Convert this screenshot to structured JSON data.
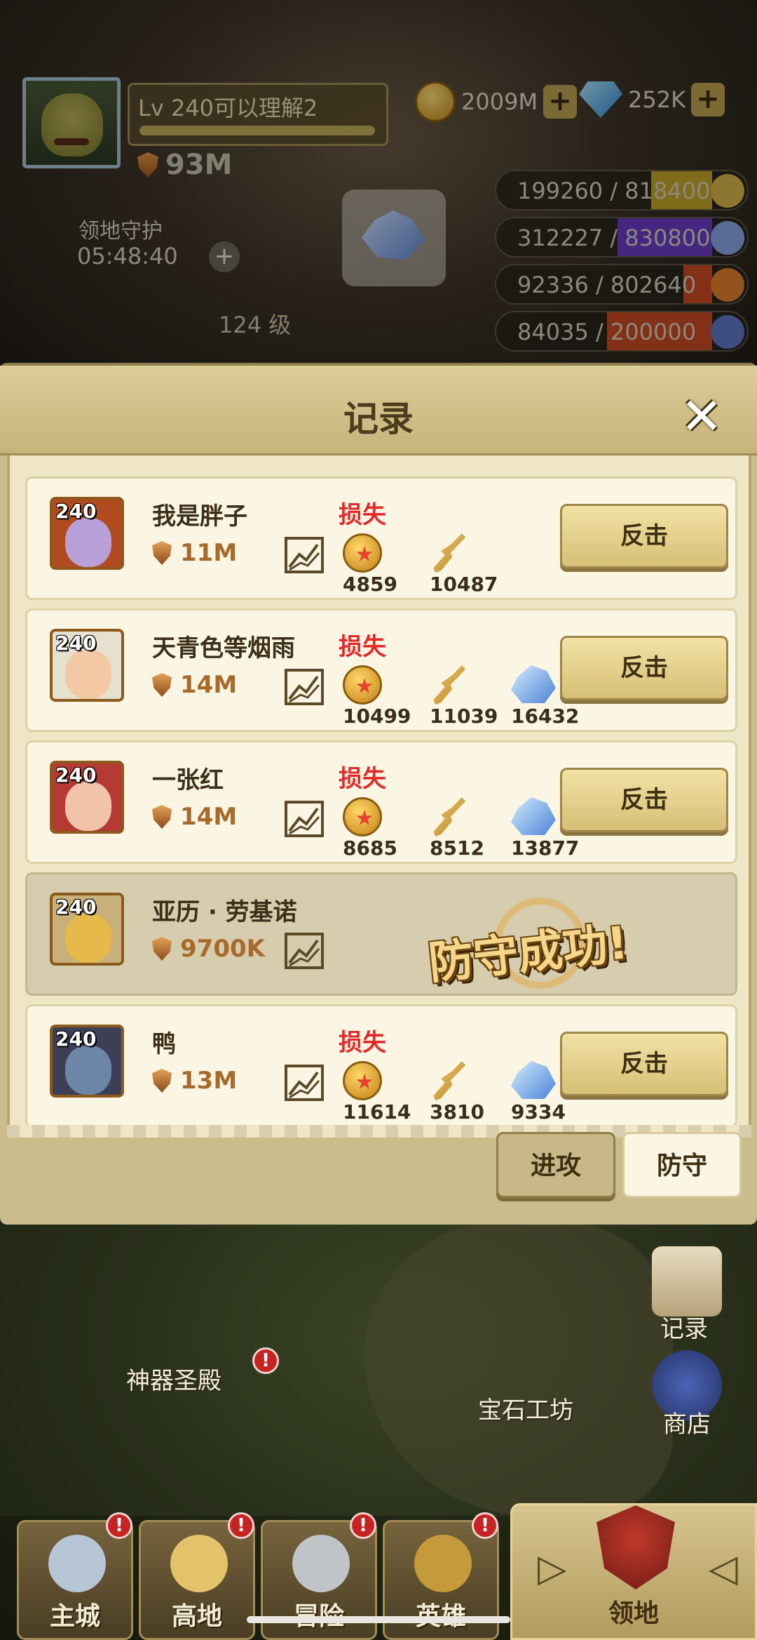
{
  "hud": {
    "player_level": "Lv 240可以理解2",
    "power": "93M",
    "territory_guard_label": "领地守护",
    "territory_guard_time": "05:48:40",
    "gold": "2009M",
    "gems": "252K",
    "building_level": "124 级"
  },
  "resources": [
    {
      "text": "199260 / 818400",
      "fill": 0.243,
      "color": "#c5a52a"
    },
    {
      "text": "312227 / 830800",
      "fill": 0.376,
      "color": "#6b3cc7"
    },
    {
      "text": "92336 / 802640",
      "fill": 0.115,
      "color": "#c94a23"
    },
    {
      "text": "84035 / 200000",
      "fill": 0.42,
      "color": "#c94a23"
    }
  ],
  "modal": {
    "title": "记录",
    "close_icon": "close-icon",
    "loss_label": "损失",
    "counter_label": "反击",
    "win_stamp": "防守成功!",
    "tabs": {
      "attack": "进攻",
      "defend": "防守"
    }
  },
  "records": [
    {
      "level": "240",
      "name": "我是胖子",
      "power": "11M",
      "result": "loss",
      "loot": {
        "gold": "4859",
        "food": "10487",
        "crystal": ""
      }
    },
    {
      "level": "240",
      "name": "天青色等烟雨",
      "power": "14M",
      "result": "loss",
      "loot": {
        "gold": "10499",
        "food": "11039",
        "crystal": "16432"
      }
    },
    {
      "level": "240",
      "name": "一张红",
      "power": "14M",
      "result": "loss",
      "loot": {
        "gold": "8685",
        "food": "8512",
        "crystal": "13877"
      }
    },
    {
      "level": "240",
      "name": "亚历 · 劳基诺",
      "power": "9700K",
      "result": "win",
      "loot": {
        "gold": "",
        "food": "",
        "crystal": ""
      }
    },
    {
      "level": "240",
      "name": "鸭",
      "power": "13M",
      "result": "loss",
      "loot": {
        "gold": "11614",
        "food": "3810",
        "crystal": "9334"
      }
    }
  ],
  "scene": {
    "artifact_hall": "神器圣殿",
    "gem_workshop": "宝石工坊",
    "record_btn": "记录",
    "shop_btn": "商店"
  },
  "nav": {
    "items": [
      "主城",
      "高地",
      "冒险",
      "英雄"
    ],
    "active": "领地"
  },
  "colors": {
    "loss": "#e02b2b",
    "power": "#a86a2a",
    "panel": "#efe6c6"
  }
}
